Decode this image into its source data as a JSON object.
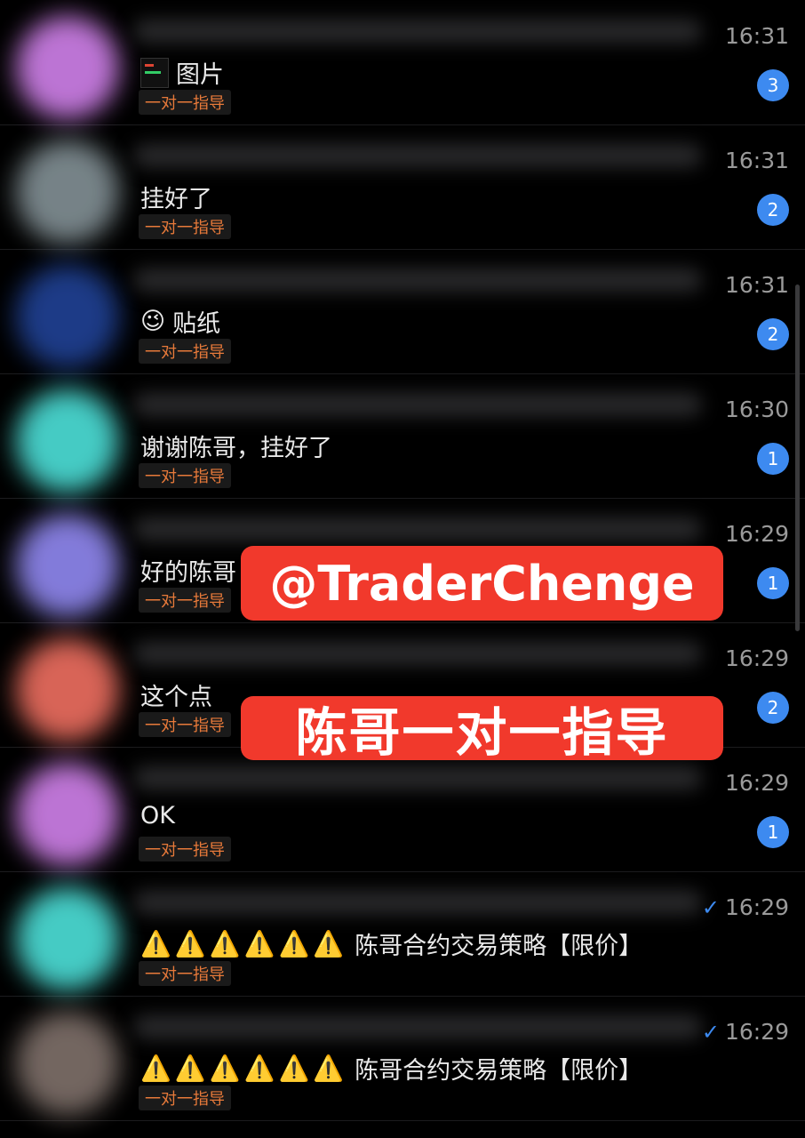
{
  "conversations": [
    {
      "preview": "图片",
      "icon": "image-thumbnail-icon",
      "tag": "一对一指导",
      "time": "16:31",
      "unread": "3",
      "avatar_color": "#c77be0"
    },
    {
      "preview": "挂好了",
      "tag": "一对一指导",
      "time": "16:31",
      "unread": "2",
      "avatar_color": "#7d8a8f"
    },
    {
      "preview": "贴纸",
      "emoji": "😉",
      "tag": "一对一指导",
      "time": "16:31",
      "unread": "2",
      "avatar_color": "#1f3f8f"
    },
    {
      "preview": "谢谢陈哥，挂好了",
      "tag": "一对一指导",
      "time": "16:30",
      "unread": "1",
      "avatar_color": "#49d6cf"
    },
    {
      "preview": "好的陈哥",
      "tag": "一对一指导",
      "time": "16:29",
      "unread": "1",
      "avatar_color": "#8a82e6"
    },
    {
      "preview": "这个点",
      "tag": "一对一指导",
      "time": "16:29",
      "unread": "2",
      "avatar_color": "#e46a5c"
    },
    {
      "preview": "OK",
      "tag": "一对一指导",
      "time": "16:29",
      "unread": "1",
      "avatar_color": "#c77be0"
    },
    {
      "preview": "陈哥合约交易策略【限价】",
      "warnings": "⚠️⚠️⚠️⚠️⚠️⚠️",
      "tag": "一对一指导",
      "time": "16:29",
      "sent_check": "✓",
      "avatar_color": "#49d6cf"
    },
    {
      "preview": "陈哥合约交易策略【限价】",
      "warnings": "⚠️⚠️⚠️⚠️⚠️⚠️",
      "tag": "一对一指导",
      "time": "16:29",
      "sent_check": "✓",
      "avatar_color": "#7a6c66"
    }
  ],
  "overlay": {
    "handle": "@TraderChenge",
    "caption": "陈哥一对一指导"
  }
}
